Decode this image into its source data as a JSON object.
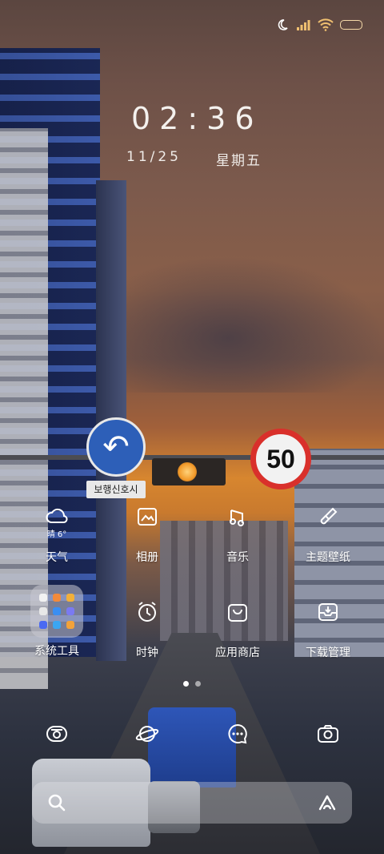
{
  "status_bar": {
    "icons": [
      "moon-icon",
      "signal-icon",
      "wifi-icon",
      "battery-icon"
    ],
    "battery_level": 1.0,
    "battery_color": "#f0a83a"
  },
  "clock": {
    "time": "02:36",
    "date": "11/25",
    "weekday": "星期五"
  },
  "apps_row1": [
    {
      "label": "天气",
      "icon": "weather-icon",
      "sub": "晴 6°"
    },
    {
      "label": "相册",
      "icon": "gallery-icon"
    },
    {
      "label": "音乐",
      "icon": "music-icon"
    },
    {
      "label": "主题壁纸",
      "icon": "theme-brush-icon"
    }
  ],
  "apps_row2": [
    {
      "label": "系统工具",
      "icon": "folder-icon"
    },
    {
      "label": "时钟",
      "icon": "clock-icon"
    },
    {
      "label": "应用商店",
      "icon": "app-store-icon"
    },
    {
      "label": "下载管理",
      "icon": "download-manager-icon"
    }
  ],
  "page_indicator": {
    "pages": 2,
    "current": 1
  },
  "dock": [
    {
      "icon": "phone-icon"
    },
    {
      "icon": "browser-planet-icon"
    },
    {
      "icon": "messages-icon"
    },
    {
      "icon": "camera-icon"
    }
  ],
  "search_bar": {
    "left_icon": "search-icon",
    "right_icon": "assistant-a-icon"
  },
  "wallpaper": {
    "sign_speed": "50",
    "sign_korean": "보행신호시"
  },
  "colors": {
    "sky_top": "#5b4640",
    "sunset": "#d7862f",
    "sign_red": "#d9302b",
    "sign_blue": "#2d5fb8"
  }
}
